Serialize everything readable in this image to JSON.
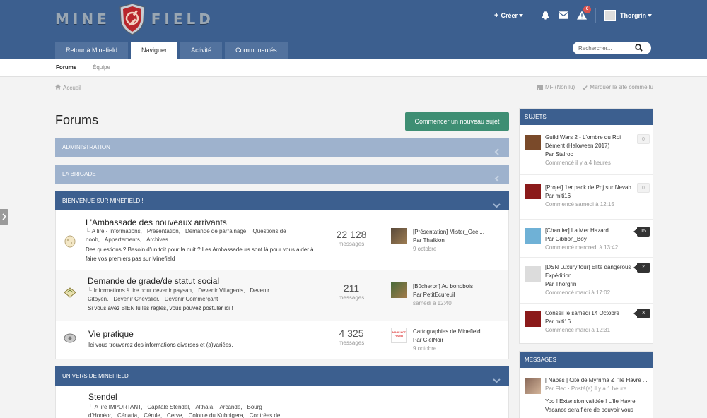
{
  "header": {
    "logo_left": "MINE",
    "logo_right": "FIELD",
    "create_label": "Créer",
    "notifications_badge": "6",
    "username": "Thorgrin",
    "search_placeholder": "Rechercher..."
  },
  "nav": {
    "tabs": [
      {
        "label": "Retour à Minefield"
      },
      {
        "label": "Naviguer"
      },
      {
        "label": "Activité"
      },
      {
        "label": "Communautés"
      }
    ]
  },
  "subnav": {
    "items": [
      {
        "label": "Forums"
      },
      {
        "label": "Équipe"
      }
    ]
  },
  "breadcrumb": {
    "home": "Accueil",
    "unread": "MF (Non lu)",
    "mark_read": "Marquer le site comme lu"
  },
  "main": {
    "title": "Forums",
    "new_topic_label": "Commencer un nouveau sujet",
    "categories": [
      {
        "label": "ADMINISTRATION"
      },
      {
        "label": "LA BRIGADE"
      },
      {
        "label": "BIENVENUE SUR MINEFIELD !"
      },
      {
        "label": "UNIVERS DE MINEFIELD"
      }
    ],
    "forums": [
      {
        "name": "L'Ambassade des nouveaux arrivants",
        "subforums": [
          "A lire - Informations,",
          "Présentation,",
          "Demande de parrainage,",
          "Questions de noob,",
          "Appartements,",
          "Archives"
        ],
        "description": "Des questions ? Besoin d'un toit pour la nuit ? Les Ambassadeurs sont là pour vous aider à faire vos premiers pas sur Minefield !",
        "count": "22 128",
        "count_label": "messages",
        "last_title": "[Présentation] Mister_Ocel...",
        "last_by": "Par Thalkion",
        "last_date": "9 octobre"
      },
      {
        "name": "Demande de grade/de statut social",
        "subforums": [
          "Informations à lire pour devenir paysan,",
          "Devenir Villageois,",
          "Devenir Citoyen,",
          "Devenir Chevalier,",
          "Devenir Commerçant"
        ],
        "description": "Si vous avez BIEN lu les règles, vous pouvez postuler ici !",
        "count": "211",
        "count_label": "messages",
        "last_title": "[Bûcheron] Au bonobois",
        "last_by": "Par PetitEcureuil",
        "last_date": "samedi à 12:40"
      },
      {
        "name": "Vie pratique",
        "subforums": [],
        "description": "Ici vous trouverez des informations diverses et (a)variées.",
        "count": "4 325",
        "count_label": "messages",
        "last_title": "Cartographies de Minefield",
        "last_by": "Par CielNoir",
        "last_date": "9 octobre",
        "last_avatar_text": "IMAGE NOT FOUND"
      },
      {
        "name": "Stendel",
        "subforums": [
          "A lire IMPORTANT,",
          "Capitale Stendel,",
          "Althaïa,",
          "Arcande,",
          "Bourg d'Honéor,",
          "Cénaria,",
          "Cérule,",
          "Cerve,",
          "Colonie du Kubnigera,",
          "Contrées de Muraë,"
        ]
      }
    ]
  },
  "sidebar": {
    "topics_title": "SUJETS",
    "topics": [
      {
        "title": "Guild Wars 2 - L'ombre du Roi Dément (Haloween 2017)",
        "by": "Par Stalroc",
        "meta": "Commencé il y a 4 heures",
        "count": "0",
        "color": "#7a4a2a"
      },
      {
        "title": "[Projet] 1er pack de Pnj sur Nevah",
        "by": "Par miti16",
        "meta": "Commencé samedi à 12:15",
        "count": "0",
        "color": "#8b1a1a"
      },
      {
        "title": "[Chantier] La Mer Hazard",
        "by": "Par Gibbon_Boy",
        "meta": "Commencé mercredi à 13:42",
        "count": "15",
        "color": "#6fb1d6"
      },
      {
        "title": "[DSN Luxury tour] Elite dangerous Expédition",
        "by": "Par Thorgrin",
        "meta": "Commencé mardi à 17:02",
        "count": "2",
        "color": "#dcdcdc"
      },
      {
        "title": "Conseil le samedi 14 Octobre",
        "by": "Par miti16",
        "meta": "Commencé mardi à 12:31",
        "count": "3",
        "color": "#8b1a1a"
      }
    ],
    "messages_title": "MESSAGES",
    "messages": [
      {
        "title": "[ Nabes ] Cité de Myrrima & l'île Havre ...",
        "meta": "Par Flec · Posté(e) il y a 1 heure",
        "excerpt": "Yoo !   Extension validée ! L'île Havre Vacance sera fière de pouvoir vous"
      }
    ]
  }
}
